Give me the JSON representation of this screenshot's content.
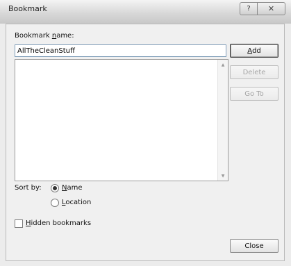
{
  "window": {
    "title": "Bookmark",
    "help_glyph": "?",
    "close_glyph": "✕"
  },
  "form": {
    "name_label_prefix": "Bookmark ",
    "name_label_u": "n",
    "name_label_suffix": "ame:",
    "name_value": "AllTheCleanStuff",
    "bookmark_list": []
  },
  "buttons": {
    "add_u": "A",
    "add_rest": "dd",
    "delete": "Delete",
    "goto": "Go To",
    "close": "Close"
  },
  "sort": {
    "label": "Sort by:",
    "name_u": "N",
    "name_rest": "ame",
    "location_u": "L",
    "location_rest": "ocation",
    "selected": "Name"
  },
  "hidden": {
    "label_u": "H",
    "label_rest": "idden bookmarks",
    "checked": false
  },
  "scroll_glyphs": {
    "up": "▲",
    "down": "▼"
  }
}
